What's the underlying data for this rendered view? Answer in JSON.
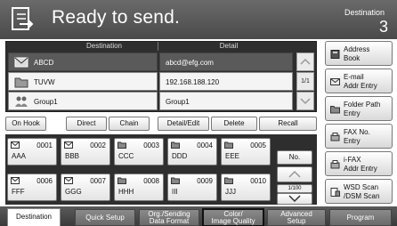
{
  "header": {
    "title": "Ready to send.",
    "destination_label": "Destination",
    "destination_count": "3"
  },
  "table": {
    "col_destination": "Destination",
    "col_detail": "Detail",
    "rows": [
      {
        "icon": "envelope-icon",
        "name": "ABCD",
        "detail": "abcd@efg.com",
        "selected": true
      },
      {
        "icon": "folder-icon",
        "name": "TUVW",
        "detail": "192.168.188.120",
        "selected": false
      },
      {
        "icon": "group-icon",
        "name": "Group1",
        "detail": "Group1",
        "selected": false
      }
    ],
    "page": "1/1"
  },
  "function_buttons": [
    {
      "label": "On Hook"
    },
    {
      "label": "Direct"
    },
    {
      "label": "Chain"
    },
    {
      "label": "Detail/Edit"
    },
    {
      "label": "Delete"
    },
    {
      "label": "Recall"
    }
  ],
  "one_touch_keys": [
    {
      "num": "0001",
      "name": "AAA",
      "icon": "envelope-icon"
    },
    {
      "num": "0002",
      "name": "BBB",
      "icon": "envelope-icon"
    },
    {
      "num": "0003",
      "name": "CCC",
      "icon": "folder-icon"
    },
    {
      "num": "0004",
      "name": "DDD",
      "icon": "folder-icon"
    },
    {
      "num": "0005",
      "name": "EEE",
      "icon": "folder-icon"
    },
    {
      "num": "0006",
      "name": "FFF",
      "icon": "envelope-icon"
    },
    {
      "num": "0007",
      "name": "GGG",
      "icon": "envelope-icon"
    },
    {
      "num": "0008",
      "name": "HHH",
      "icon": "folder-icon"
    },
    {
      "num": "0009",
      "name": "III",
      "icon": "folder-icon"
    },
    {
      "num": "0010",
      "name": "JJJ",
      "icon": "folder-icon"
    }
  ],
  "keys_nav": {
    "no_label": "No.",
    "page": "1/100"
  },
  "right_buttons": [
    {
      "icon": "address-book-icon",
      "line1": "Address",
      "line2": "Book"
    },
    {
      "icon": "envelope-icon",
      "line1": "E-mail",
      "line2": "Addr Entry"
    },
    {
      "icon": "folder-icon",
      "line1": "Folder Path",
      "line2": "Entry"
    },
    {
      "icon": "fax-icon",
      "line1": "FAX No.",
      "line2": "Entry"
    },
    {
      "icon": "ifax-icon",
      "line1": "i-FAX",
      "line2": "Addr Entry"
    },
    {
      "icon": "wsd-scan-icon",
      "line1": "WSD Scan",
      "line2": "/DSM Scan"
    }
  ],
  "tabs": [
    {
      "line1": "Destination",
      "line2": "",
      "active": true,
      "boxed": false
    },
    {
      "line1": "Quick Setup",
      "line2": "",
      "active": false,
      "boxed": false
    },
    {
      "line1": "Org./Sending",
      "line2": "Data Format",
      "active": false,
      "boxed": false
    },
    {
      "line1": "Color/",
      "line2": "Image Quality",
      "active": false,
      "boxed": true
    },
    {
      "line1": "Advanced",
      "line2": "Setup",
      "active": false,
      "boxed": false
    },
    {
      "line1": "Program",
      "line2": "",
      "active": false,
      "boxed": false
    }
  ]
}
